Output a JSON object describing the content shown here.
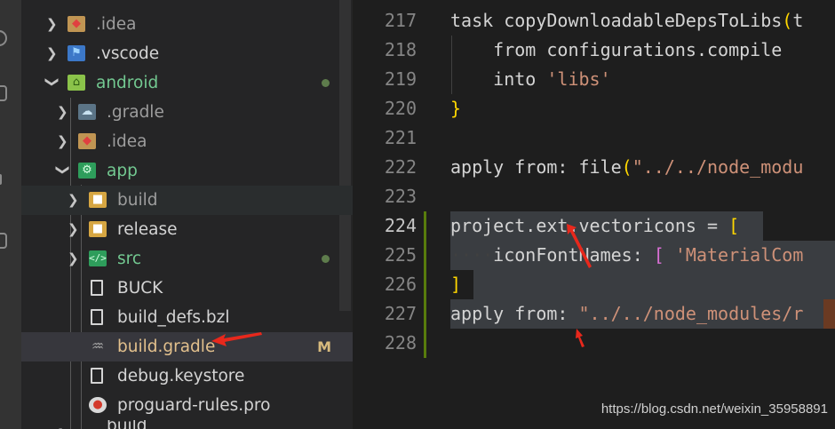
{
  "explorer": {
    "items": [
      {
        "label": ".idea",
        "icon": "folder-idea-icon"
      },
      {
        "label": ".vscode",
        "icon": "folder-vscode-icon"
      },
      {
        "label": "android",
        "icon": "folder-android-icon"
      },
      {
        "label": ".gradle",
        "icon": "folder-gradle-icon"
      },
      {
        "label": ".idea",
        "icon": "folder-idea-icon"
      },
      {
        "label": "app",
        "icon": "folder-app-icon"
      },
      {
        "label": "build",
        "icon": "folder-icon"
      },
      {
        "label": "release",
        "icon": "folder-icon"
      },
      {
        "label": "src",
        "icon": "folder-src-icon"
      },
      {
        "label": "BUCK",
        "icon": "file-icon"
      },
      {
        "label": "build_defs.bzl",
        "icon": "file-icon"
      },
      {
        "label": "build.gradle",
        "icon": "gradle-elephant-icon",
        "badge": "M"
      },
      {
        "label": "debug.keystore",
        "icon": "file-icon"
      },
      {
        "label": "proguard-rules.pro",
        "icon": "proguard-icon"
      },
      {
        "label": "build",
        "icon": "folder-icon"
      }
    ]
  },
  "editor": {
    "lines": [
      {
        "num": "217"
      },
      {
        "num": "218"
      },
      {
        "num": "219"
      },
      {
        "num": "220"
      },
      {
        "num": "221"
      },
      {
        "num": "222"
      },
      {
        "num": "223"
      },
      {
        "num": "224"
      },
      {
        "num": "225"
      },
      {
        "num": "226"
      },
      {
        "num": "227"
      },
      {
        "num": "228"
      }
    ],
    "code": {
      "l217_a": "task copyDownloadableDepsToLibs",
      "l217_b": "(",
      "l217_c": "t",
      "l218": "    from configurations.compile",
      "l219_a": "    into ",
      "l219_b": "'libs'",
      "l220": "}",
      "l222_a": "apply from: file",
      "l222_b": "(",
      "l222_c": "\"../../node_modu",
      "l224_a": "project.ext.vectoricons = ",
      "l224_b": "[",
      "l225_ws": "····",
      "l225_a": "iconFontNames: ",
      "l225_b": "[",
      "l225_c": " 'MaterialCom",
      "l226": "]",
      "l227_a": "apply from: ",
      "l227_b": "\"../../node_modules/r"
    }
  },
  "watermark": "https://blog.csdn.net/weixin_35958891",
  "colors": {
    "accent_modified": "#d7ba7d",
    "diff_added": "#587c0c",
    "arrow": "#e8281c"
  }
}
